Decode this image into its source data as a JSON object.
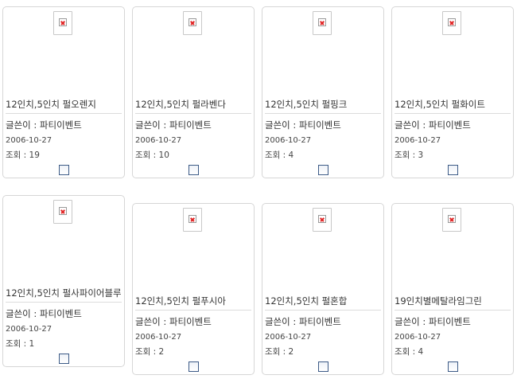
{
  "posts": [
    {
      "title": "12인치,5인치 펄오렌지",
      "author_label": "글쓴이 : 파티이벤트",
      "date": "2006-10-27",
      "views_label": "조회 : 19"
    },
    {
      "title": "12인치,5인치 펄라벤다",
      "author_label": "글쓴이 : 파티이벤트",
      "date": "2006-10-27",
      "views_label": "조회 : 10"
    },
    {
      "title": "12인치,5인치 펄핑크",
      "author_label": "글쓴이 : 파티이벤트",
      "date": "2006-10-27",
      "views_label": "조회 : 4"
    },
    {
      "title": "12인치,5인치 펄화이트",
      "author_label": "글쓴이 : 파티이벤트",
      "date": "2006-10-27",
      "views_label": "조회 : 3"
    },
    {
      "title": "12인치,5인치 펄사파이어블루",
      "author_label": "글쓴이 : 파티이벤트",
      "date": "2006-10-27",
      "views_label": "조회 : 1"
    },
    {
      "title": "12인치,5인치 펄푸시아",
      "author_label": "글쓴이 : 파티이벤트",
      "date": "2006-10-27",
      "views_label": "조회 : 2"
    },
    {
      "title": "12인치,5인치 펄혼합",
      "author_label": "글쓴이 : 파티이벤트",
      "date": "2006-10-27",
      "views_label": "조회 : 2"
    },
    {
      "title": "19인치별메탈라임그린",
      "author_label": "글쓴이 : 파티이벤트",
      "date": "2006-10-27",
      "views_label": "조회 : 4"
    }
  ]
}
